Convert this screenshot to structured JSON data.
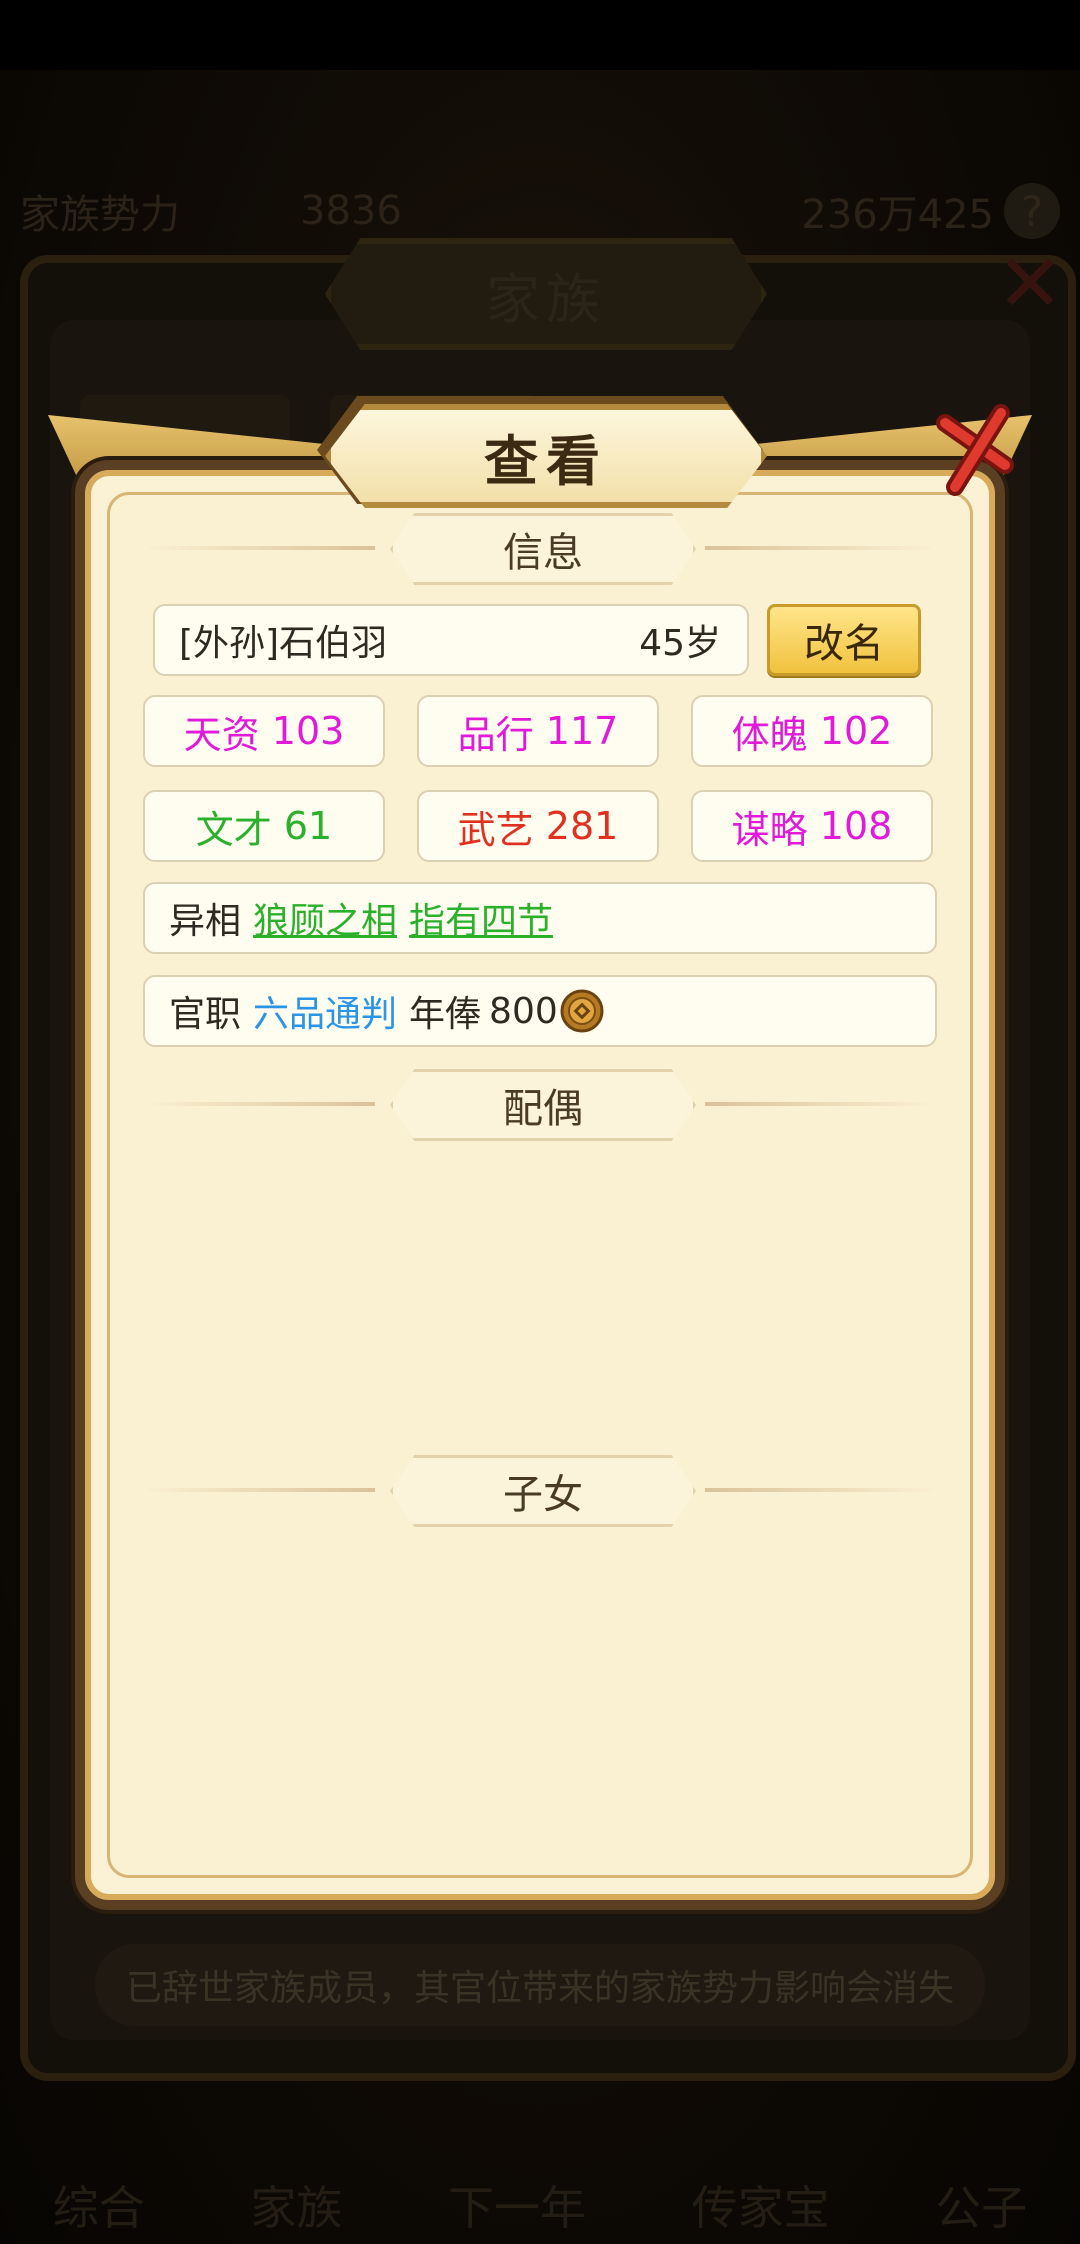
{
  "background": {
    "top_stat_label": "家族势力",
    "top_stat_value": "3836",
    "resource_value": "236万425",
    "family_title": "家族",
    "notice": "已辞世家族成员，其官位带来的家族势力影响会消失",
    "nav": [
      "综合",
      "家族",
      "下一年",
      "传家宝",
      "公子"
    ]
  },
  "dialog": {
    "title": "查看",
    "sections": {
      "info": "信息",
      "spouse": "配偶",
      "children": "子女"
    },
    "member": {
      "name": "[外孙]石伯羽",
      "age": "45岁",
      "rename_label": "改名"
    },
    "stats": [
      {
        "label": "天资",
        "value": "103",
        "color": "#e01ad8"
      },
      {
        "label": "品行",
        "value": "117",
        "color": "#e01ad8"
      },
      {
        "label": "体魄",
        "value": "102",
        "color": "#e01ad8"
      },
      {
        "label": "文才",
        "value": "61",
        "color": "#2bb02b"
      },
      {
        "label": "武艺",
        "value": "281",
        "color": "#e0301f"
      },
      {
        "label": "谋略",
        "value": "108",
        "color": "#e01ad8"
      }
    ],
    "traits": {
      "label": "异相",
      "items": [
        "狼顾之相",
        "指有四节"
      ]
    },
    "office": {
      "label": "官职",
      "rank": "六品通判",
      "salary_label": "年俸",
      "salary_value": "800"
    }
  }
}
